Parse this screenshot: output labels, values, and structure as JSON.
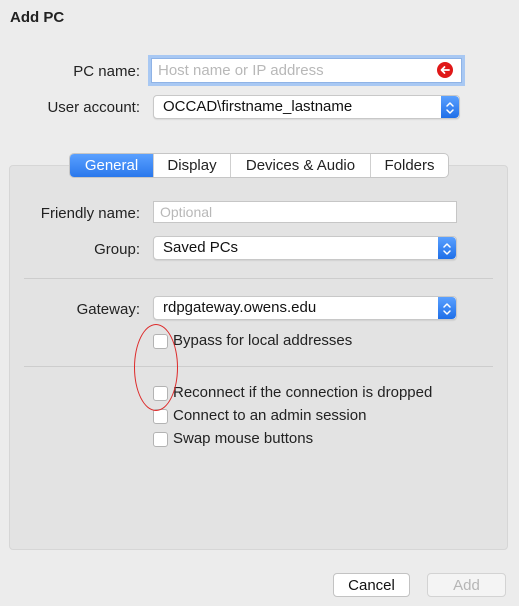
{
  "dialog": {
    "title": "Add PC"
  },
  "form": {
    "pc_name": {
      "label": "PC name:",
      "value": "",
      "placeholder": "Host name or IP address"
    },
    "user_account": {
      "label": "User account:",
      "selected": "OCCAD\\firstname_lastname"
    }
  },
  "tabs": [
    {
      "label": "General",
      "active": true
    },
    {
      "label": "Display",
      "active": false
    },
    {
      "label": "Devices & Audio",
      "active": false
    },
    {
      "label": "Folders",
      "active": false
    }
  ],
  "general": {
    "friendly_name": {
      "label": "Friendly name:",
      "value": "",
      "placeholder": "Optional"
    },
    "group": {
      "label": "Group:",
      "selected": "Saved PCs"
    },
    "gateway": {
      "label": "Gateway:",
      "selected": "rdpgateway.owens.edu"
    },
    "bypass_local": {
      "label": "Bypass for local addresses",
      "checked": false
    },
    "reconnect": {
      "label": "Reconnect if the connection is dropped",
      "checked": false
    },
    "admin_session": {
      "label": "Connect to an admin session",
      "checked": false
    },
    "swap_mouse": {
      "label": "Swap mouse buttons",
      "checked": false
    }
  },
  "buttons": {
    "cancel": "Cancel",
    "add": "Add"
  },
  "icons": {
    "clear": "clear-field-icon",
    "popup_arrows": "up-down-chevron-icon"
  },
  "colors": {
    "accent_blue": "#2a78ec",
    "focus_ring": "#a8c8f3",
    "clear_red": "#e01818",
    "annotation_red": "#dd2a2a"
  }
}
